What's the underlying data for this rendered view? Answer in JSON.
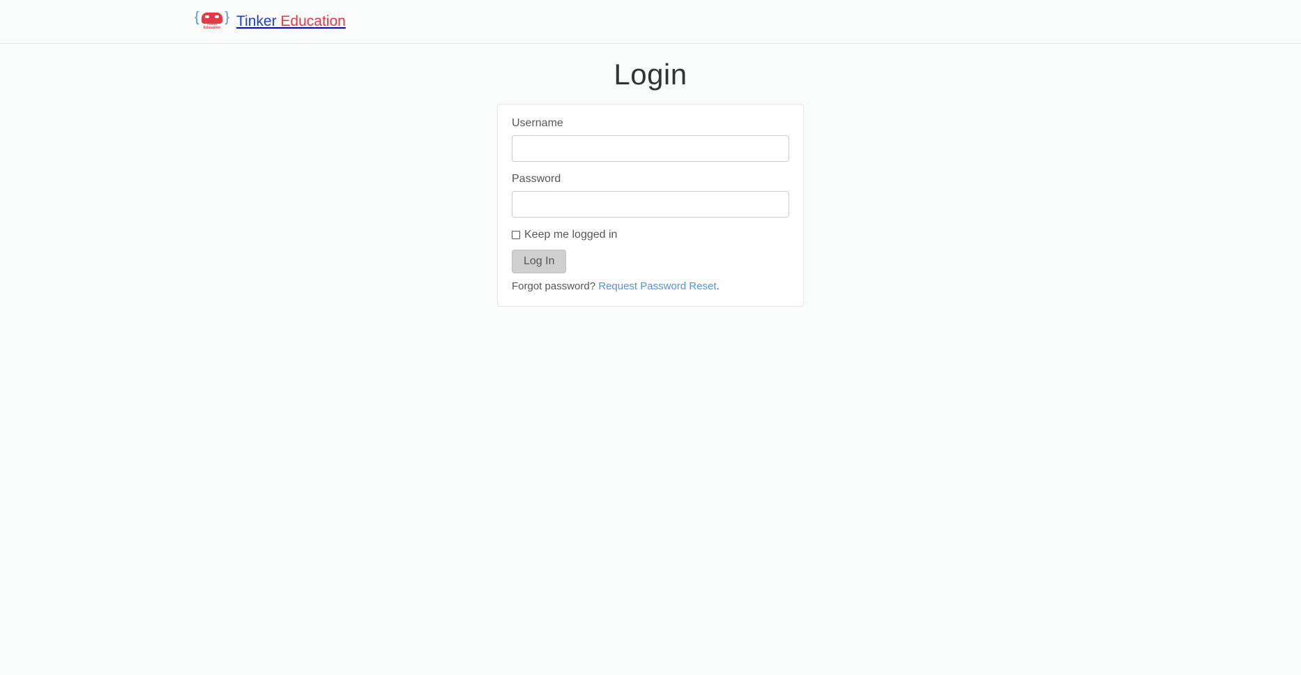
{
  "header": {
    "brand_part1": "Tinker ",
    "brand_part2": "Education",
    "logo_small_text": "Tinker Education"
  },
  "login": {
    "title": "Login",
    "username_label": "Username",
    "password_label": "Password",
    "keep_logged_in_label": "Keep me logged in",
    "login_button_label": "Log In",
    "forgot_text": "Forgot password? ",
    "reset_link_text": "Request Password Reset",
    "period": "."
  }
}
